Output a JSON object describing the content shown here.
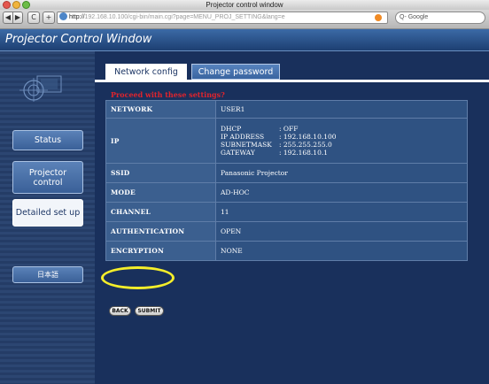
{
  "browser": {
    "window_title": "Projector control window",
    "buttons": {
      "back": "◀",
      "forward": "▶",
      "reload": "C",
      "add": "+"
    },
    "url_scheme": "http://",
    "url_rest": "192.168.10.100/cgi-bin/main.cgi?page=MENU_PROJ_SETTING&lang=e",
    "search_placeholder": "Q- Google",
    "colors": {
      "close": "#e4574f",
      "minimize": "#f0b43d",
      "maximize": "#6cbd48"
    }
  },
  "page": {
    "title": "Projector Control Window",
    "sidebar": {
      "items": [
        {
          "label": "Status",
          "active": false
        },
        {
          "label": "Projector control",
          "active": false
        },
        {
          "label": "Detailed set up",
          "active": true
        },
        {
          "label": "日本語",
          "active": false
        }
      ]
    },
    "tabs": [
      {
        "label": "Network config",
        "active": true
      },
      {
        "label": "Change password",
        "active": false
      }
    ],
    "notice": "Proceed with these settings?",
    "settings": {
      "network": {
        "label": "NETWORK",
        "value": "USER1"
      },
      "ip": {
        "label": "IP",
        "rows": [
          {
            "key": "DHCP",
            "value": ": OFF"
          },
          {
            "key": "IP ADDRESS",
            "value": ": 192.168.10.100"
          },
          {
            "key": "SUBNETMASK",
            "value": ": 255.255.255.0"
          },
          {
            "key": "GATEWAY",
            "value": ": 192.168.10.1"
          }
        ]
      },
      "ssid": {
        "label": "SSID",
        "value": "Panasonic Projector"
      },
      "mode": {
        "label": "MODE",
        "value": "AD-HOC"
      },
      "channel": {
        "label": "CHANNEL",
        "value": "11"
      },
      "authentication": {
        "label": "AUTHENTICATION",
        "value": "OPEN"
      },
      "encryption": {
        "label": "ENCRYPTION",
        "value": "NONE"
      }
    },
    "buttons": {
      "back": "BACK",
      "submit": "SUBMIT"
    },
    "colors": {
      "accent_highlight": "#f5ee2a",
      "notice_red": "#e0242d",
      "background": "#19305c"
    }
  }
}
